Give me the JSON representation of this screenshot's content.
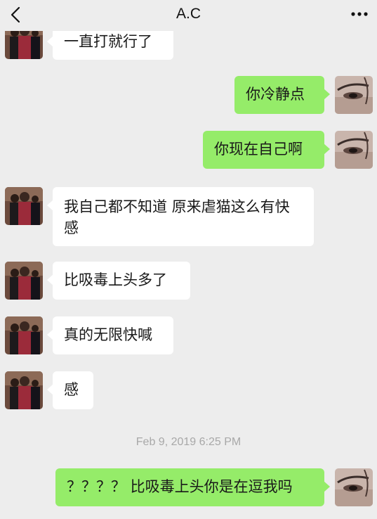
{
  "header": {
    "title": "A.C",
    "back_icon": "chevron-left-icon",
    "more_icon": "more-dots-icon"
  },
  "messages": [
    {
      "side": "in",
      "text": "一直打就行了"
    },
    {
      "side": "out",
      "text": "你冷静点"
    },
    {
      "side": "out",
      "text": "你现在自己啊"
    },
    {
      "side": "in",
      "text": "我自己都不知道 原来虐猫这么有快感"
    },
    {
      "side": "in",
      "text": "比吸毒上头多了"
    },
    {
      "side": "in",
      "text": "真的无限快喊"
    },
    {
      "side": "in",
      "text": "感"
    },
    {
      "side": "out",
      "text": "？？？？ 比吸毒上头你是在逗我吗"
    }
  ],
  "timestamp": "Feb 9, 2019 6:25 PM",
  "colors": {
    "background": "#ededed",
    "outgoing_bubble": "#95ec69",
    "incoming_bubble": "#ffffff"
  }
}
